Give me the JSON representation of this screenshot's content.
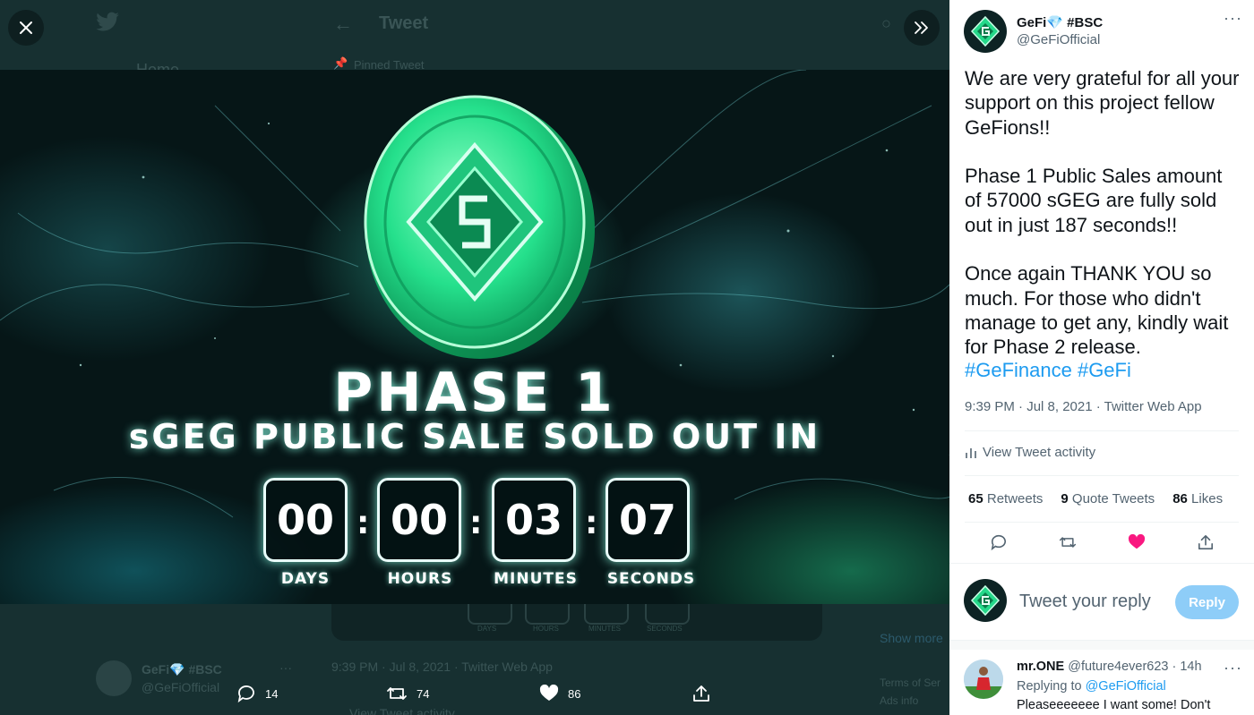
{
  "backdrop": {
    "header_title": "Tweet",
    "pinned": "Pinned Tweet",
    "nav_home": "Home",
    "countdown_labels": [
      "DAYS",
      "HOURS",
      "MINUTES",
      "SECONDS"
    ],
    "timestamp": "9:39 PM · Jul 8, 2021 · Twitter Web App",
    "view_activity": "View Tweet activity",
    "author_name": "GeFi💎 #BSC",
    "author_handle": "@GeFiOfficial",
    "show_more": "Show more",
    "terms": "Terms of Ser",
    "ads_info": "Ads info"
  },
  "hero": {
    "title": "PHASE 1",
    "subtitle": "sGEG PUBLIC SALE SOLD OUT IN",
    "countdown": [
      {
        "value": "00",
        "label": "DAYS"
      },
      {
        "value": "00",
        "label": "HOURS"
      },
      {
        "value": "03",
        "label": "MINUTES"
      },
      {
        "value": "07",
        "label": "SECONDS"
      }
    ],
    "accent": "#25e08c"
  },
  "bottom_bar": {
    "replies": "14",
    "retweets": "74",
    "likes": "86"
  },
  "tweet": {
    "author_name": "GeFi💎 #BSC",
    "author_handle": "@GeFiOfficial",
    "body": "We are very grateful for all your support on this project fellow GeFions!!\n\nPhase 1 Public Sales amount of 57000 sGEG are fully sold out in just 187 seconds!!\n\nOnce again THANK YOU so much. For those who didn't manage to get any, kindly wait for Phase 2 release.",
    "hashtags": "#GeFinance #GeFi",
    "meta": "9:39 PM · Jul 8, 2021 · Twitter Web App",
    "view_activity": "View Tweet activity",
    "retweets_count": "65",
    "retweets_label": "Retweets",
    "quotes_count": "9",
    "quotes_label": "Quote Tweets",
    "likes_count": "86",
    "likes_label": "Likes",
    "like_color": "#f91880"
  },
  "reply_box": {
    "placeholder": "Tweet your reply",
    "button": "Reply"
  },
  "reply": {
    "name": "mr.ONE",
    "handle_time": "@future4ever623 · 14h",
    "replying_prefix": "Replying to",
    "replying_to": "@GeFiOfficial",
    "text": "Pleaseeeeeee I want some! Don't"
  }
}
